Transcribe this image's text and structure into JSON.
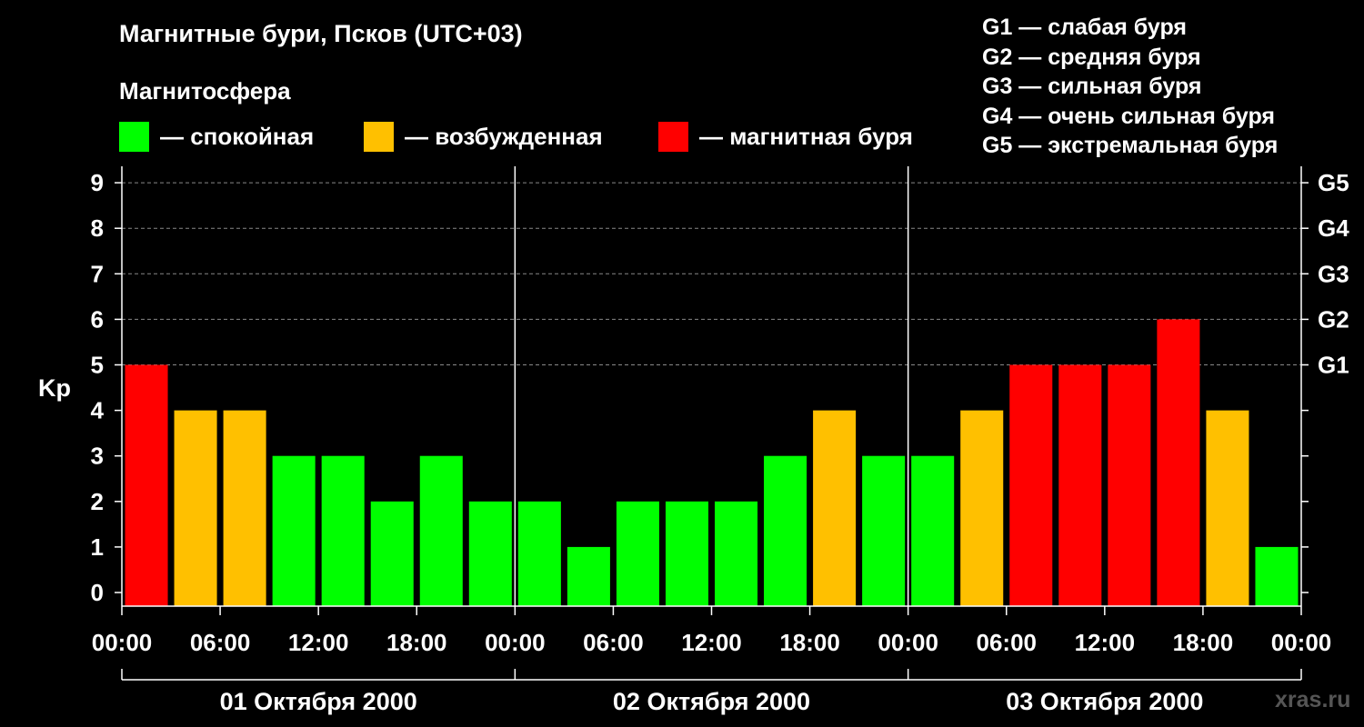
{
  "header": {
    "title": "Магнитные бури, Псков (UTC+03)",
    "subtitle": "Магнитосфера"
  },
  "legend": [
    {
      "label": "— спокойная",
      "color": "#00ff00"
    },
    {
      "label": "— возбужденная",
      "color": "#ffc000"
    },
    {
      "label": "— магнитная буря",
      "color": "#ff0000"
    }
  ],
  "g_scale": [
    "G1 — слабая буря",
    "G2 — средняя буря",
    "G3 — сильная буря",
    "G4 — очень сильная буря",
    "G5 — экстремальная буря"
  ],
  "watermark": "xras.ru",
  "chart_data": {
    "type": "bar",
    "ylabel": "Kp",
    "ylim": [
      0,
      9
    ],
    "y_ticks": [
      "0",
      "1",
      "2",
      "3",
      "4",
      "5",
      "6",
      "7",
      "8",
      "9"
    ],
    "right_ticks": {
      "5": "G1",
      "6": "G2",
      "7": "G3",
      "8": "G4",
      "9": "G5"
    },
    "x_tick_labels": [
      "00:00",
      "06:00",
      "12:00",
      "18:00",
      "00:00",
      "06:00",
      "12:00",
      "18:00",
      "00:00",
      "06:00",
      "12:00",
      "18:00",
      "00:00"
    ],
    "days": [
      "01 Октября 2000",
      "02 Октября 2000",
      "03 Октября 2000"
    ],
    "values": [
      5,
      4,
      4,
      3,
      3,
      2,
      3,
      2,
      2,
      1,
      2,
      2,
      2,
      3,
      4,
      3,
      3,
      4,
      5,
      5,
      5,
      6,
      4,
      1
    ],
    "colors": {
      "quiet": "#00ff00",
      "active": "#ffc000",
      "storm": "#ff0000"
    },
    "grid": "dashed lines at Kp 5–9"
  }
}
